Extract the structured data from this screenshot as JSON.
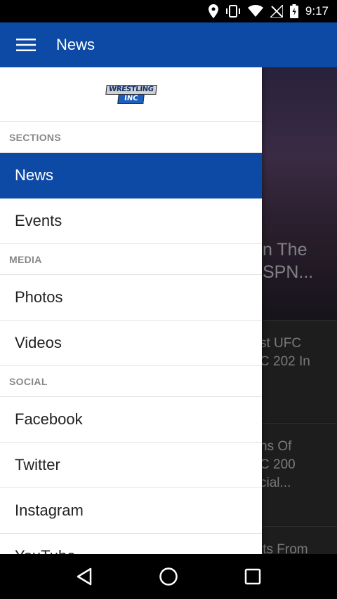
{
  "status_bar": {
    "time": "9:17"
  },
  "app_bar": {
    "title": "News"
  },
  "drawer": {
    "logo": {
      "line1": "WRESTLING",
      "line2": "INC"
    },
    "sections": [
      {
        "header": "SECTIONS",
        "items": [
          "News",
          "Events"
        ]
      },
      {
        "header": "MEDIA",
        "items": [
          "Photos",
          "Videos"
        ]
      },
      {
        "header": "SOCIAL",
        "items": [
          "Facebook",
          "Twitter",
          "Instagram",
          "YouTube"
        ]
      }
    ],
    "active_item": "News"
  },
  "background_feed": {
    "hero_title": "n The\nSPN...",
    "items": [
      "st UFC\nC 202 In",
      "ns Of\nC 200\ncial...",
      "lts From"
    ]
  },
  "colors": {
    "primary": "#0c4aa6",
    "status_bar": "#000000",
    "drawer_bg": "#ffffff"
  }
}
